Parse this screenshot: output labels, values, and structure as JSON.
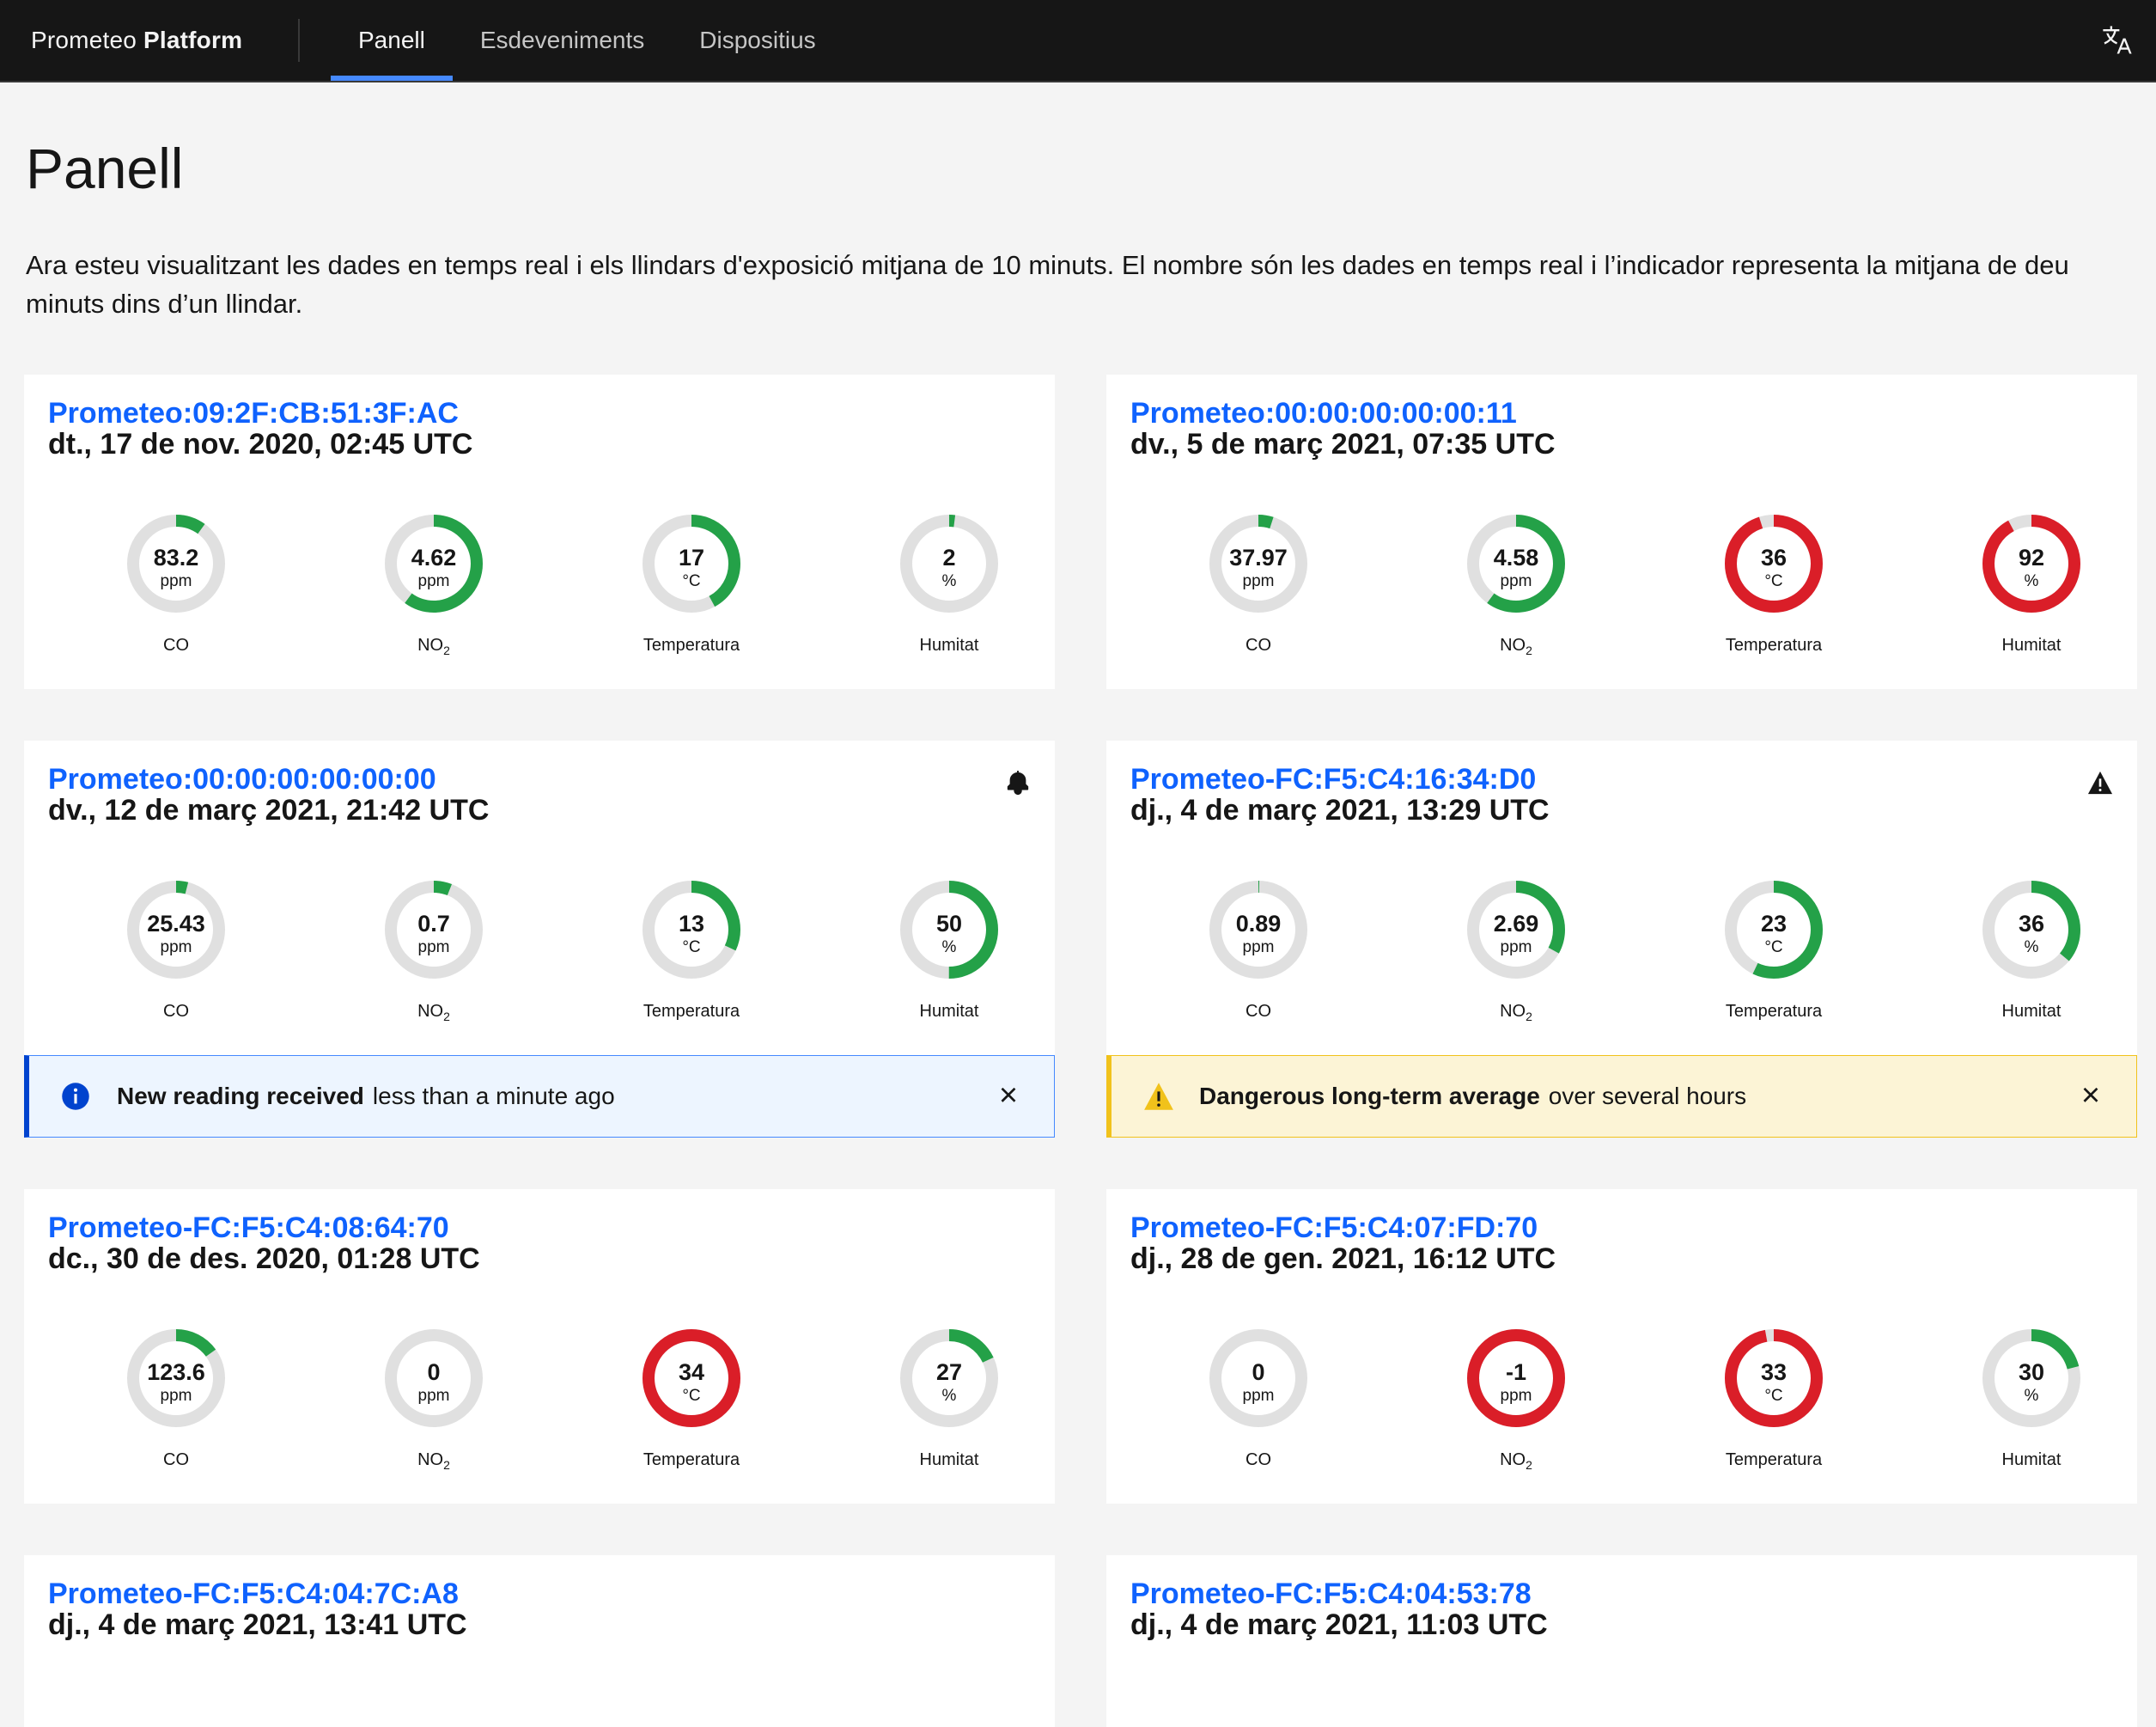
{
  "header": {
    "brand_prefix": "Prometeo",
    "brand_suffix": "Platform",
    "nav": [
      {
        "label": "Panell",
        "active": true
      },
      {
        "label": "Esdeveniments",
        "active": false
      },
      {
        "label": "Dispositius",
        "active": false
      }
    ],
    "language_icon": "translate-icon"
  },
  "page": {
    "title": "Panell",
    "description": "Ara esteu visualitzant les dades en temps real i els llindars d'exposició mitjana de 10 minuts. El nombre són les dades en temps real i l’indicador representa la mitjana de deu minuts dins d’un llindar."
  },
  "labels": {
    "co": "CO",
    "no2_main": "NO",
    "no2_sub": "2",
    "temp": "Temperatura",
    "hum": "Humitat",
    "unit_ppm": "ppm",
    "unit_c": "°C",
    "unit_pct": "%"
  },
  "colors": {
    "ok": "#24a148",
    "danger": "#da1e28",
    "track": "#e0e0e0",
    "link": "#0f62fe"
  },
  "devices": [
    {
      "name": "Prometeo:09:2F:CB:51:3F:AC",
      "date": "dt., 17 de nov. 2020, 02:45 UTC",
      "icon": "",
      "gauges": [
        {
          "value": "83.2",
          "fraction": 0.1,
          "status": "ok"
        },
        {
          "value": "4.62",
          "fraction": 0.6,
          "status": "ok"
        },
        {
          "value": "17",
          "fraction": 0.42,
          "status": "ok"
        },
        {
          "value": "2",
          "fraction": 0.02,
          "status": "ok"
        }
      ]
    },
    {
      "name": "Prometeo:00:00:00:00:00:11",
      "date": "dv., 5 de març 2021, 07:35 UTC",
      "icon": "",
      "gauges": [
        {
          "value": "37.97",
          "fraction": 0.05,
          "status": "ok"
        },
        {
          "value": "4.58",
          "fraction": 0.6,
          "status": "ok"
        },
        {
          "value": "36",
          "fraction": 0.95,
          "status": "danger"
        },
        {
          "value": "92",
          "fraction": 0.92,
          "status": "danger"
        }
      ]
    },
    {
      "name": "Prometeo:00:00:00:00:00:00",
      "date": "dv., 12 de març 2021, 21:42 UTC",
      "icon": "bell-icon",
      "gauges": [
        {
          "value": "25.43",
          "fraction": 0.04,
          "status": "ok"
        },
        {
          "value": "0.7",
          "fraction": 0.06,
          "status": "ok"
        },
        {
          "value": "13",
          "fraction": 0.32,
          "status": "ok"
        },
        {
          "value": "50",
          "fraction": 0.5,
          "status": "ok"
        }
      ],
      "notification": {
        "kind": "info",
        "icon": "info-icon",
        "title": "New reading received",
        "subtitle": "less than a minute ago"
      }
    },
    {
      "name": "Prometeo-FC:F5:C4:16:34:D0",
      "date": "dj., 4 de març 2021, 13:29 UTC",
      "icon": "warning-icon",
      "gauges": [
        {
          "value": "0.89",
          "fraction": 0.003,
          "status": "ok"
        },
        {
          "value": "2.69",
          "fraction": 0.33,
          "status": "ok"
        },
        {
          "value": "23",
          "fraction": 0.57,
          "status": "ok"
        },
        {
          "value": "36",
          "fraction": 0.36,
          "status": "ok"
        }
      ],
      "notification": {
        "kind": "warn",
        "icon": "warning-icon",
        "title": "Dangerous long-term average",
        "subtitle": "over several hours"
      }
    },
    {
      "name": "Prometeo-FC:F5:C4:08:64:70",
      "date": "dc., 30 de des. 2020, 01:28 UTC",
      "icon": "",
      "gauges": [
        {
          "value": "123.6",
          "fraction": 0.15,
          "status": "ok"
        },
        {
          "value": "0",
          "fraction": 0.0,
          "status": "ok"
        },
        {
          "value": "34",
          "fraction": 1.0,
          "status": "danger"
        },
        {
          "value": "27",
          "fraction": 0.18,
          "status": "ok"
        }
      ]
    },
    {
      "name": "Prometeo-FC:F5:C4:07:FD:70",
      "date": "dj., 28 de gen. 2021, 16:12 UTC",
      "icon": "",
      "gauges": [
        {
          "value": "0",
          "fraction": 0.0,
          "status": "ok"
        },
        {
          "value": "-1",
          "fraction": 1.0,
          "status": "danger"
        },
        {
          "value": "33",
          "fraction": 0.97,
          "status": "danger"
        },
        {
          "value": "30",
          "fraction": 0.21,
          "status": "ok"
        }
      ]
    },
    {
      "name": "Prometeo-FC:F5:C4:04:7C:A8",
      "date": "dj., 4 de març 2021, 13:41 UTC",
      "icon": "",
      "gauges": []
    },
    {
      "name": "Prometeo-FC:F5:C4:04:53:78",
      "date": "dj., 4 de març 2021, 11:03 UTC",
      "icon": "",
      "gauges": []
    }
  ]
}
